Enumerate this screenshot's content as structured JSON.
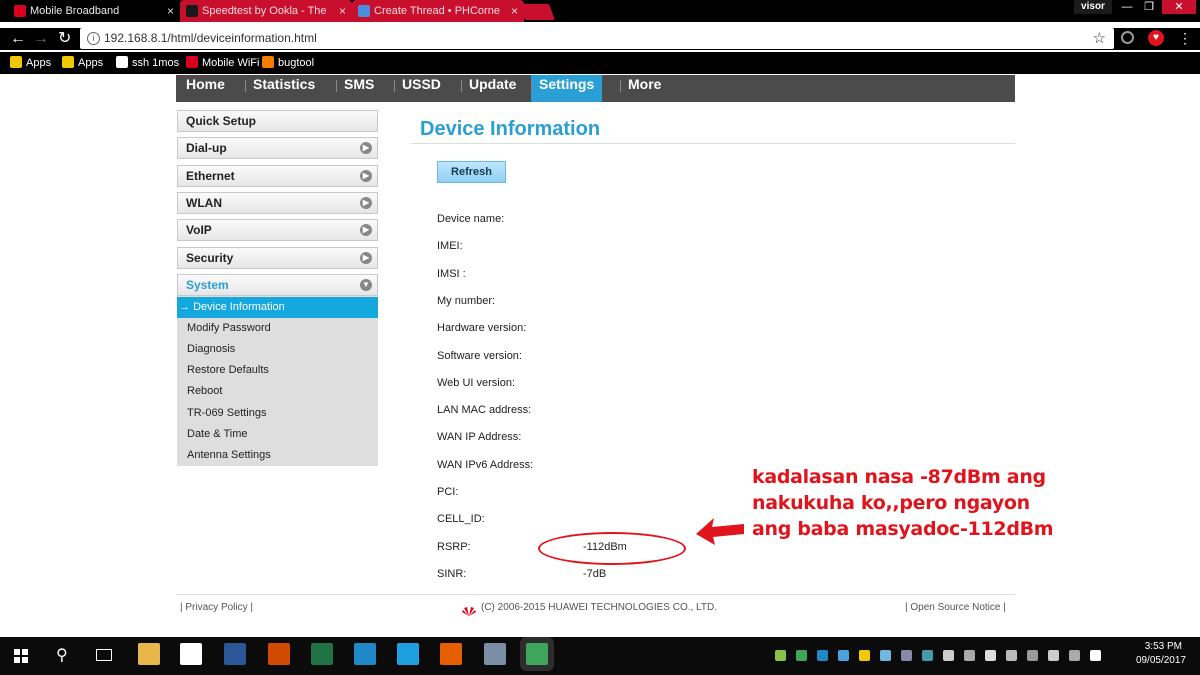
{
  "browser": {
    "tabs": [
      {
        "title": "Mobile Broadband",
        "active": true,
        "favicon_color": "#d9001b"
      },
      {
        "title": "Speedtest by Ookla - The",
        "active": false,
        "favicon_color": "#1a1a1a"
      },
      {
        "title": "Create Thread • PHCorne",
        "active": false,
        "favicon_color": "#4b8ede"
      }
    ],
    "user_chip": "visor",
    "window_controls": {
      "minimize": "—",
      "restore": "❐",
      "close": "✕"
    },
    "url": "192.168.8.1/html/deviceinformation.html",
    "bookmarks": [
      {
        "label": "Apps",
        "icon": "apps-grid-icon",
        "color": "#f0c808"
      },
      {
        "label": "Apps",
        "icon": "apps-grid-icon",
        "color": "#f0c808"
      },
      {
        "label": "ssh 1mos",
        "icon": "key-icon",
        "color": "#ffffff"
      },
      {
        "label": "Mobile WiFi",
        "icon": "huawei-logo-icon",
        "color": "#d9001b"
      },
      {
        "label": "bugtool",
        "icon": "blogger-icon",
        "color": "#f57d00"
      }
    ]
  },
  "router": {
    "menu": [
      "Home",
      "Statistics",
      "SMS",
      "USSD",
      "Update",
      "Settings",
      "More"
    ],
    "menu_selected": "Settings",
    "sidebar": [
      "Quick Setup",
      "Dial-up",
      "Ethernet",
      "WLAN",
      "VoIP",
      "Security",
      "System"
    ],
    "submenu": [
      "Device Information",
      "Modify Password",
      "Diagnosis",
      "Restore Defaults",
      "Reboot",
      "TR-069 Settings",
      "Date & Time",
      "Antenna Settings"
    ],
    "submenu_selected_prefix": "→",
    "page_title": "Device Information",
    "refresh_label": "Refresh",
    "fields": [
      {
        "label": "Device name:",
        "value": ""
      },
      {
        "label": "IMEI:",
        "value": ""
      },
      {
        "label": "IMSI :",
        "value": ""
      },
      {
        "label": "My number:",
        "value": ""
      },
      {
        "label": "Hardware version:",
        "value": ""
      },
      {
        "label": "Software version:",
        "value": ""
      },
      {
        "label": "Web UI version:",
        "value": ""
      },
      {
        "label": "LAN MAC address:",
        "value": ""
      },
      {
        "label": "WAN IP Address:",
        "value": ""
      },
      {
        "label": "WAN IPv6 Address:",
        "value": ""
      },
      {
        "label": "PCI:",
        "value": ""
      },
      {
        "label": "CELL_ID:",
        "value": ""
      },
      {
        "label": "RSRP:",
        "value": "-112dBm"
      },
      {
        "label": "SINR:",
        "value": "-7dB"
      }
    ],
    "annotation": "kadalasan nasa -87dBm ang nakukuha ko,,pero ngayon ang baba masyadoc-112dBm",
    "footer": {
      "privacy": "Privacy Policy",
      "copyright": "(C) 2006-2015 HUAWEI TECHNOLOGIES CO., LTD.",
      "open_source": "Open Source Notice"
    },
    "colors": {
      "accent": "#2a9fd6",
      "annotation": "#e0141c",
      "menu_bg": "#4b4b4b"
    }
  },
  "taskbar": {
    "time": "3:53 PM",
    "date": "09/05/2017",
    "apps": [
      {
        "icon": "file-explorer-icon",
        "color": "#e8b64a"
      },
      {
        "icon": "store-icon",
        "color": "#ffffff"
      },
      {
        "icon": "word-icon",
        "color": "#2b5797"
      },
      {
        "icon": "photoshop-icon",
        "color": "#d04a02"
      },
      {
        "icon": "excel-icon",
        "color": "#1f7244"
      },
      {
        "icon": "network-icon",
        "color": "#1e88c8"
      },
      {
        "icon": "internet-explorer-icon",
        "color": "#1ea0e0"
      },
      {
        "icon": "firefox-icon",
        "color": "#e66000"
      },
      {
        "icon": "app-icon",
        "color": "#7a8fa6"
      },
      {
        "icon": "chrome-icon",
        "color": "#3ea55b"
      }
    ]
  }
}
